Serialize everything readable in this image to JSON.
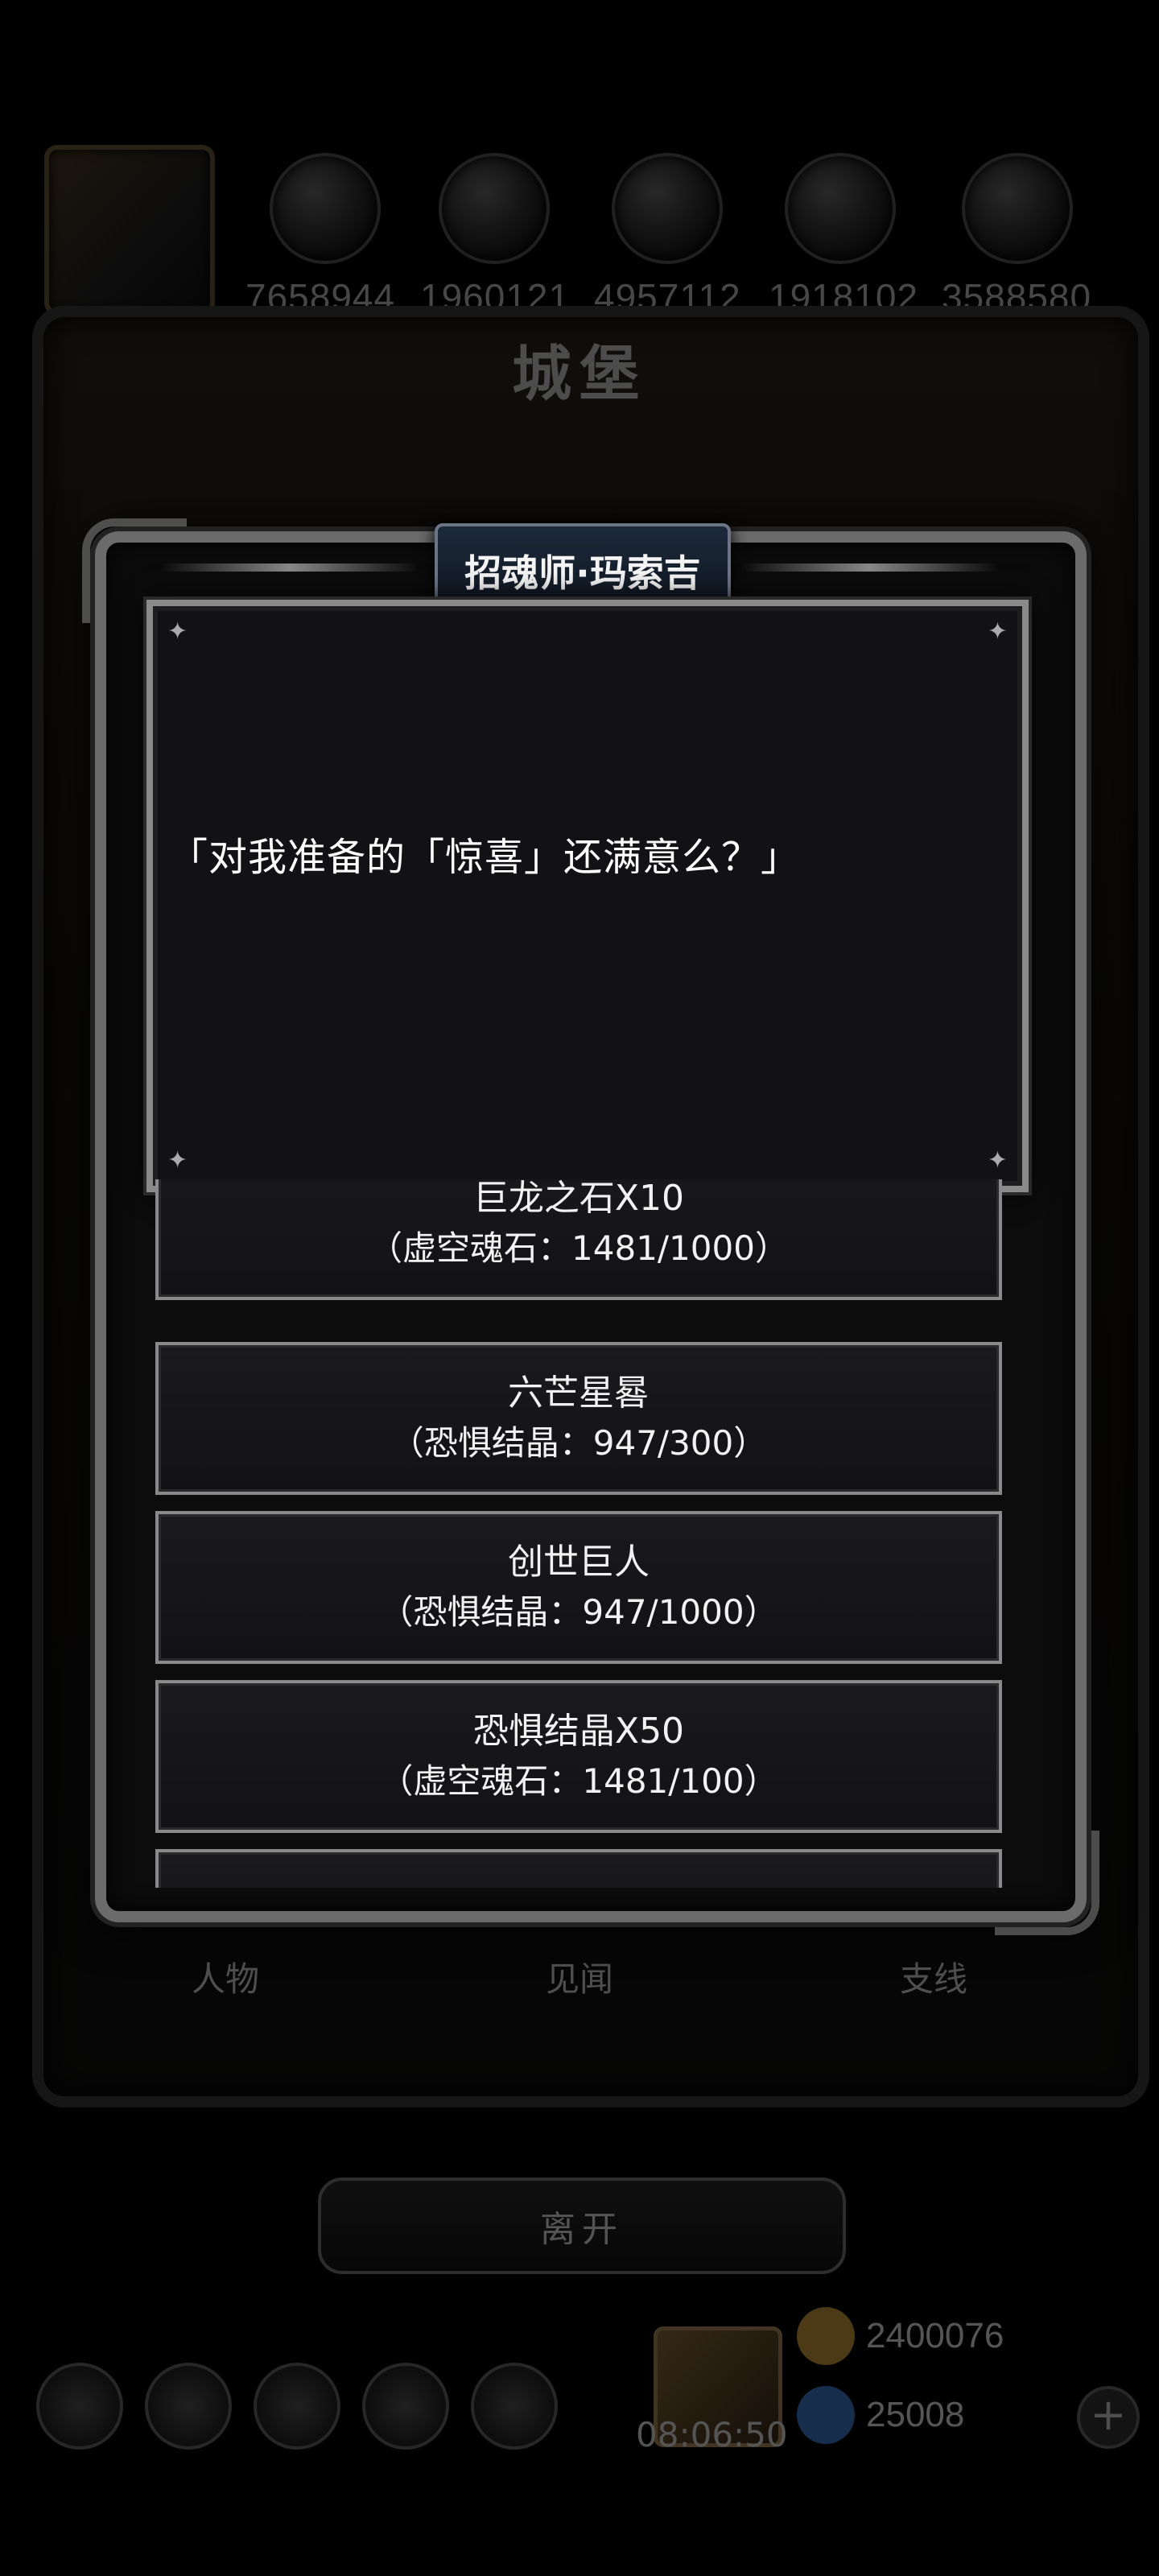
{
  "top_bar": {
    "resources": [
      "7658944",
      "1960121",
      "4957112",
      "1918102",
      "3588580"
    ]
  },
  "castle": {
    "title": "城堡"
  },
  "tabs": [
    "人物",
    "见闻",
    "支线"
  ],
  "leave_button": "离开",
  "timer": "08:06:50",
  "currencies": [
    {
      "name": "gold-coin",
      "value": "2400076",
      "color": "#c79a3a"
    },
    {
      "name": "blue-gem",
      "value": "25008",
      "color": "#3a7ac7"
    }
  ],
  "popup": {
    "npc_name": "招魂师·玛索吉",
    "dialog": "「对我准备的「惊喜」还满意么？」",
    "options": [
      {
        "name": "巨龙之石X10",
        "cost": "（虚空魂石：1481/1000）"
      },
      {
        "name": "六芒星晷",
        "cost": "（恐惧结晶：947/300）"
      },
      {
        "name": "创世巨人",
        "cost": "（恐惧结晶：947/1000）"
      },
      {
        "name": "恐惧结晶X50",
        "cost": "（虚空魂石：1481/100）"
      }
    ]
  },
  "colors": {
    "frame": "#6b6b6b",
    "panel": "#121214",
    "banner": "#1d2a3a"
  }
}
